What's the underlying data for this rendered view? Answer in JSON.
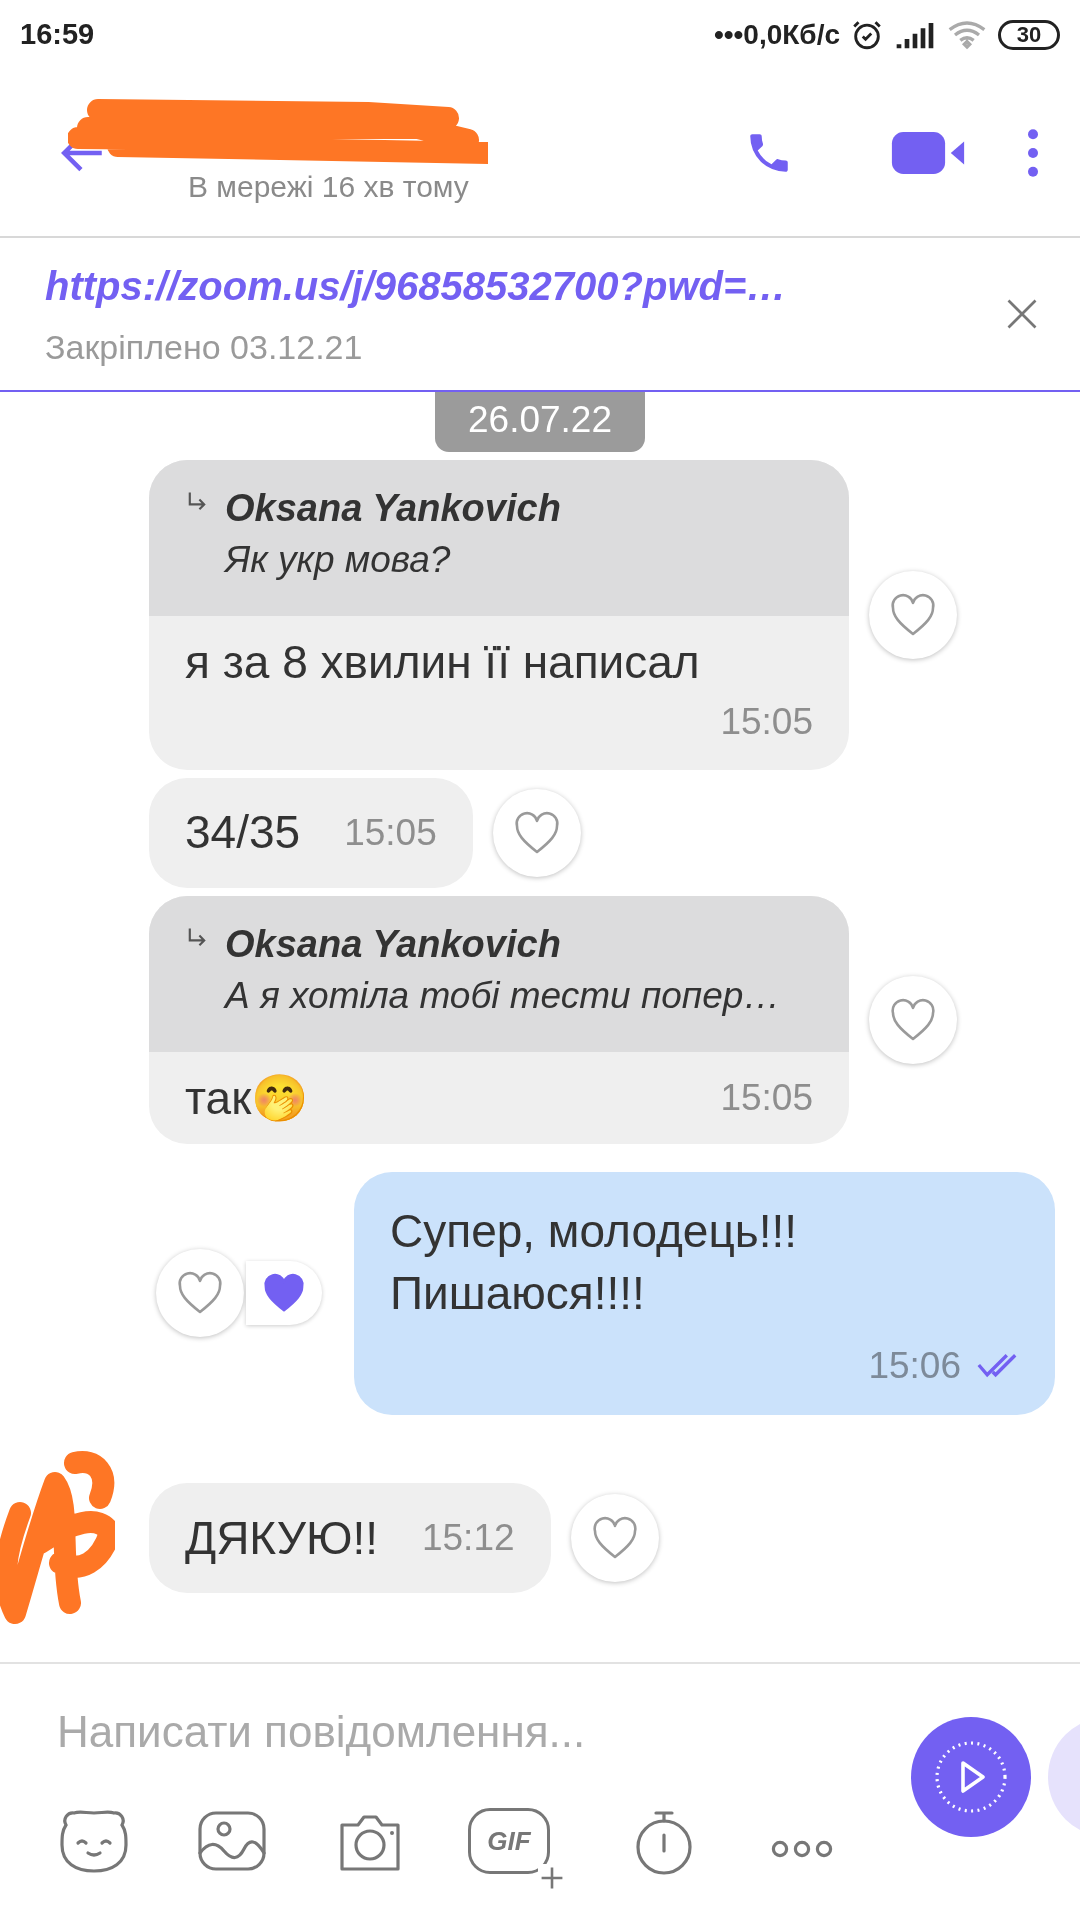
{
  "status_bar": {
    "time": "16:59",
    "network_speed": "•••0,0Кб/с",
    "battery": "30"
  },
  "header": {
    "subtitle": "В мережі 16 хв тому"
  },
  "pinned": {
    "link": "https://zoom.us/j/96858532700?pwd=…",
    "label": "Закріплено 03.12.21"
  },
  "date_chip": "26.07.22",
  "messages": [
    {
      "kind": "incoming",
      "quote": {
        "author": "Oksana Yankovich",
        "text": "Як укр мова?"
      },
      "text": "я за 8 хвилин її написал",
      "time": "15:05",
      "liked": false
    },
    {
      "kind": "incoming",
      "text": "34/35",
      "time": "15:05",
      "liked": false
    },
    {
      "kind": "incoming",
      "quote": {
        "author": "Oksana Yankovich",
        "text": "А я хотіла тобі тести попер…"
      },
      "text": "так🤭",
      "time": "15:05",
      "liked": false
    },
    {
      "kind": "outgoing",
      "text": "Супер, молодець!!!\nПишаюся!!!!",
      "time": "15:06",
      "read": true,
      "liked": false,
      "liked_by_peer": true
    },
    {
      "kind": "incoming",
      "avatar": true,
      "text": "ДЯКУЮ!!",
      "time": "15:12",
      "liked": false
    }
  ],
  "composer": {
    "placeholder": "Написати повідомлення...",
    "tools": [
      {
        "kind": "sticker"
      },
      {
        "kind": "image"
      },
      {
        "kind": "camera"
      },
      {
        "kind": "gif",
        "label": "GIF"
      },
      {
        "kind": "timer"
      },
      {
        "kind": "more"
      }
    ]
  }
}
